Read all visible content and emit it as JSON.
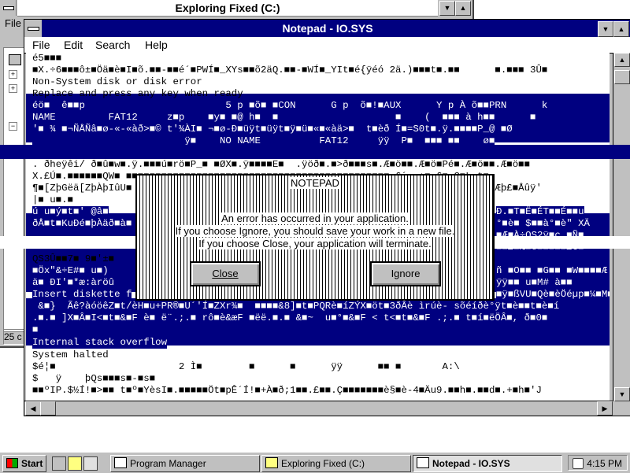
{
  "explorer": {
    "title": "Exploring Fixed (C:)",
    "menu_fragment": "File",
    "status_fragment": "25 c"
  },
  "notepad": {
    "title": "Notepad - IO.SYS",
    "menu": {
      "file": "File",
      "edit": "Edit",
      "search": "Search",
      "help": "Help"
    },
    "lines": [
      "é5■■■",
      "■X.÷6■■■ô±■Öä■è■I■õ.■■-■■é´■PWÍ■_XYs■■õ2äQ.■■-■WÍ■_YIt■é{ÿéó 2ä.)■■■t■.■■      ■.■■■ 3Û■",
      "Non-System disk or disk error",
      "Replace and press any key when ready",
      "éö■  ê■■p                        5 p ■õ■ ■CON      G p  õ■!■AUX      Y p À õ■■PRN      k",
      "NAME         FAT12     z■p    ■y■ ■@ h■  ■                    ■    (  ■■■ à h■■      ■",
      "'■ ¾ ■¬ÑÅÑâ■ø-«-«àð>■© t'¾ÀI■ ¬■ø-Ð■üÿt■üÿt■ÿ■ü■«■«àä>■  t■èð Í■=S0t■.ÿ.■■■■P_@ ■Ø",
      "                          ÿ■    NO NAME          FAT12     ÿÿ  P■  ■■■ ■■    ø■",
      "",
      ". ðheÿêi/ ð■û■w■.ÿ.■■■ú■rö■P_■ ■ØX■.ÿ■■■■E■  .ÿöð■.■>ð■■■s■.Æ■ö■■.Æ■ö■Pé■.Æ■ö■■.Æ■ö■■",
      "X.£Ú■.■■■■■■QW■ ■■■■■■■■■■■■■■■■■■■■■■■■■■■■■■■■■■■■■■■■■■■■■ £´ .¡■.£■ Ç■L t■",
      "¶■[ZþGëä[ZþÀþIûU■                                                        ■■¾ ð■Æþ£■Åûÿ'",
      "|■ u■.■  ",
      "ú u■ý■t■' @â■",
      "ðÅ■t■KuÐé■þÀäð■à■",
      "",
      "",
      "QS3Û■■7■ 9■'±■",
      "■Öx\"&÷E#■ u■)",
      "ä■ ÐI'■*æ:àröû",
      "Insert diskette f",
      " &■}  Ãê?àóöêZ■t/èH■u+PR®■U´'Í■ZXr¾■  ■■■■&8]■t■PQRè■íZÝX■öt■3ðÂè ìrúè- sõéíðè°ÿt■è■■t■è■í",
      ".■.■ ]X■Â■I<■t■&■F è■ ë¨.;.■ rô■è&æF ■ëë.■.■ &■~  u■°■&■F < t<■t■&■F .;.■ t■í■ëÖÂ■, ð■0■",
      "■",
      "Internal stack overflow",
      "System halted",
      "$é¦■                     2 Ì■        ■      ■      ÿÿ      ■■ ■       A:\\",
      "$   ÿ    þQs■■■s■-■s■",
      "■■ºIP.$½Í!■>■■ t■º■YèsI■.■■■■■Öt■pÊ´Í!■+À■ð;1■■.£■■.Ç■■■■■■■è§■è-4■Äu9.■■h■.■■d■.+■h■'J"
    ],
    "right_fragments": {
      "r13": "Ð.■T■Ë■ÉT■■É■■u",
      "r14": "°■è■ $■■à°■è\" XÄ",
      "r15": "■Æ■À÷QS2ÿ■ç ■Ñ■",
      "r16": "■■£■Æ■é■■■■■£C■",
      "r18": "ñ ■O■■ ■G■■ ■W■■■■Æ",
      "r19": "ÿÿ■■ u■M# à■■",
      "r20": "■ÿ■ßVU■Qè■èÖéµp■¼■M■&÷E"
    }
  },
  "dialog": {
    "title": "NOTEPAD",
    "line1": "An error has occurred in your application.",
    "line2": "If you choose Ignore, you should save your work in a new file.",
    "line3": "If you choose Close, your application will terminate.",
    "close_label": "Close",
    "ignore_label": "Ignore"
  },
  "taskbar": {
    "start_label": "Start",
    "tasks": [
      "Program Manager",
      "Exploring Fixed (C:)",
      "Notepad - IO.SYS"
    ],
    "clock": "4:15 PM"
  }
}
